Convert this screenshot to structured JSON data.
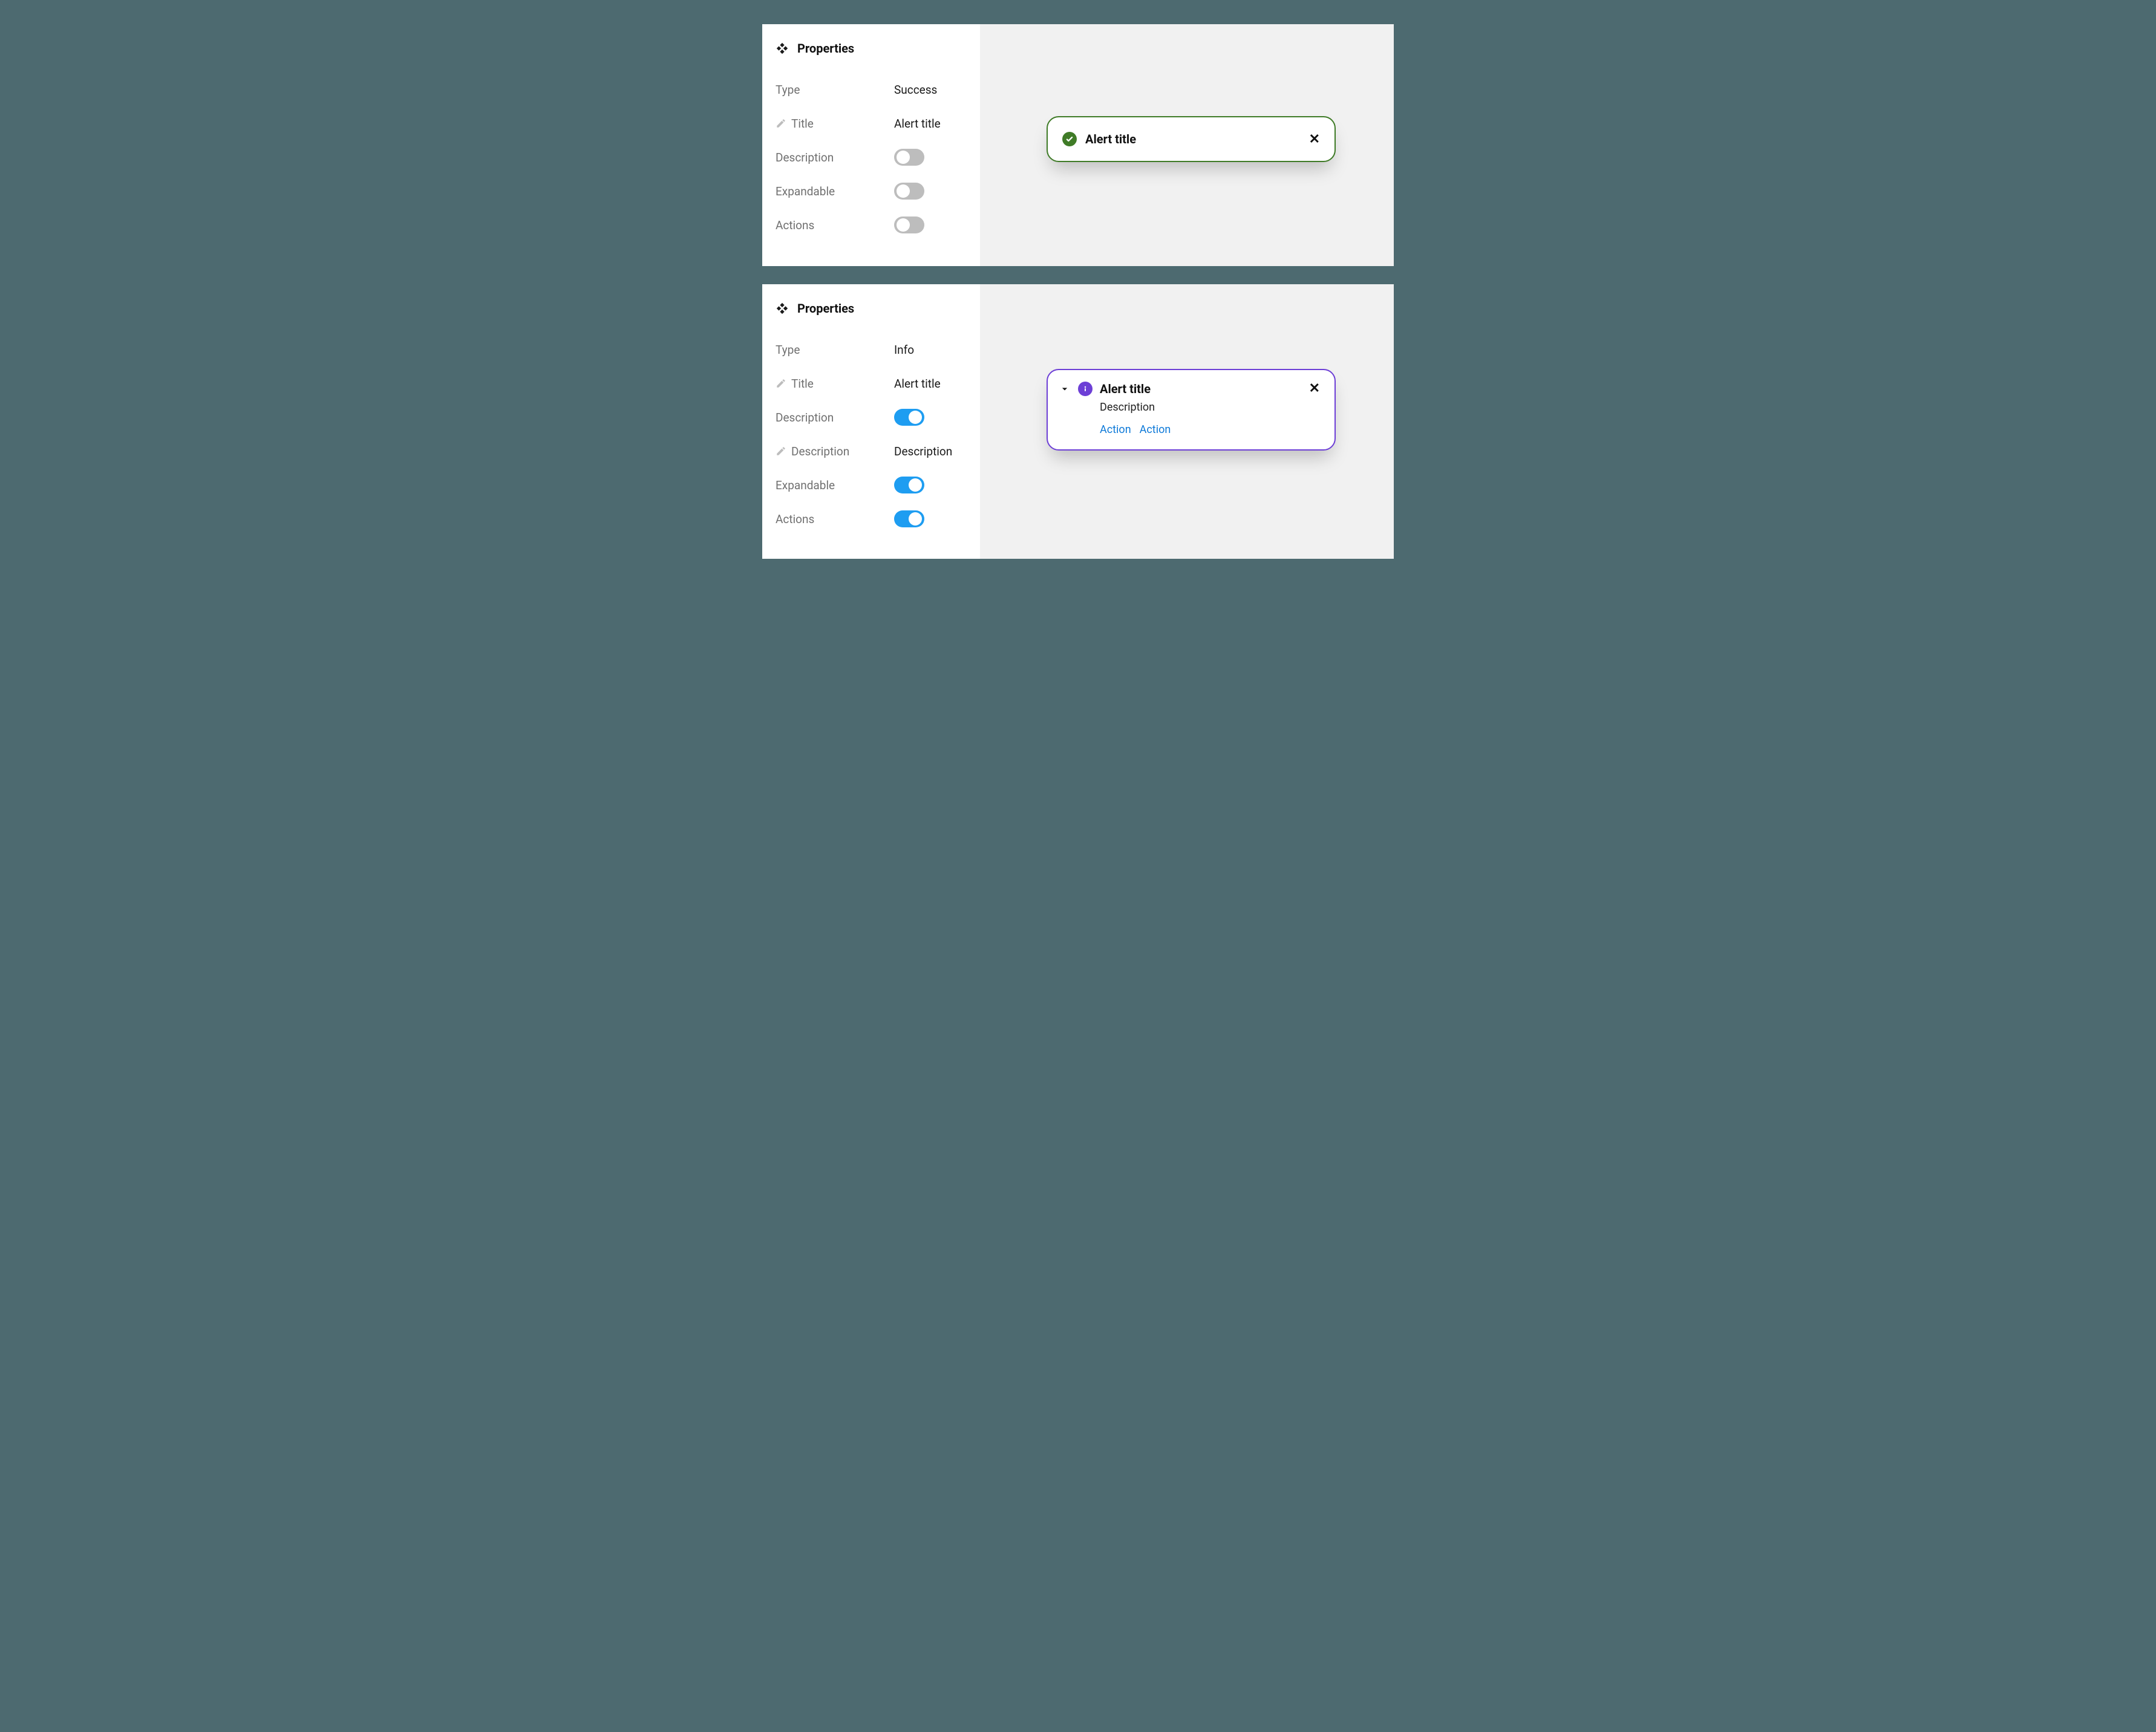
{
  "panels": [
    {
      "header": "Properties",
      "rows": {
        "type_label": "Type",
        "type_value": "Success",
        "title_label": "Title",
        "title_value": "Alert title",
        "description_label": "Description",
        "description_on": false,
        "expandable_label": "Expandable",
        "expandable_on": false,
        "actions_label": "Actions",
        "actions_on": false
      },
      "alert": {
        "kind": "success",
        "accent": "#3f7b27",
        "title": "Alert title"
      }
    },
    {
      "header": "Properties",
      "rows": {
        "type_label": "Type",
        "type_value": "Info",
        "title_label": "Title",
        "title_value": "Alert title",
        "description_toggle_label": "Description",
        "description_toggle_on": true,
        "description_field_label": "Description",
        "description_field_value": "Description",
        "expandable_label": "Expandable",
        "expandable_on": true,
        "actions_label": "Actions",
        "actions_on": true
      },
      "alert": {
        "kind": "info",
        "accent": "#6d3fd6",
        "title": "Alert title",
        "description": "Description",
        "actions": [
          "Action",
          "Action"
        ]
      }
    }
  ]
}
